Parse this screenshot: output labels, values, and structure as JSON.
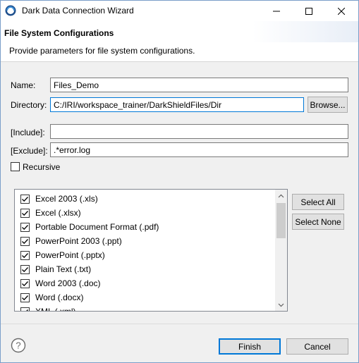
{
  "window": {
    "title": "Dark Data Connection Wizard"
  },
  "banner": {
    "title": "File System Configurations",
    "description": "Provide parameters for file system configurations."
  },
  "form": {
    "name_label": "Name:",
    "name_value": "Files_Demo",
    "directory_label": "Directory:",
    "directory_value": "C:/IRI/workspace_trainer/DarkShieldFiles/Dir",
    "browse_label": "Browse...",
    "include_label": "[Include]:",
    "include_value": "",
    "exclude_label": "[Exclude]:",
    "exclude_value": ".*error.log",
    "recursive_label": "Recursive",
    "recursive_checked": false
  },
  "file_types": {
    "items": [
      {
        "label": "Excel 2003 (.xls)",
        "checked": true
      },
      {
        "label": "Excel (.xlsx)",
        "checked": true
      },
      {
        "label": "Portable Document Format (.pdf)",
        "checked": true
      },
      {
        "label": "PowerPoint 2003 (.ppt)",
        "checked": true
      },
      {
        "label": "PowerPoint (.pptx)",
        "checked": true
      },
      {
        "label": "Plain Text (.txt)",
        "checked": true
      },
      {
        "label": "Word 2003 (.doc)",
        "checked": true
      },
      {
        "label": "Word (.docx)",
        "checked": true
      },
      {
        "label": "XML (.xml)",
        "checked": true
      }
    ],
    "select_all_label": "Select All",
    "select_none_label": "Select None"
  },
  "footer": {
    "finish_label": "Finish",
    "cancel_label": "Cancel"
  },
  "colors": {
    "accent": "#0078d7",
    "window_bg": "#f0f0f0"
  }
}
